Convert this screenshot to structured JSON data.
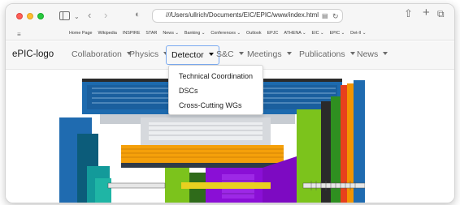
{
  "browser": {
    "url": "///Users/ullrich/Documents/EIC/EPIC/www/index.html"
  },
  "bookmarks": [
    "Home Page",
    "Wikipedia",
    "INSPIRE",
    "STAR",
    "News ⌄",
    "Banking ⌄",
    "Conferences ⌄",
    "Outlook",
    "EPJC",
    "ATHENA ⌄",
    "EIC ⌄",
    "EPIC ⌄",
    "Det-II ⌄"
  ],
  "navbar": {
    "brand": "ePIC-logo",
    "items": [
      {
        "label": "Collaboration"
      },
      {
        "label": "Physics"
      },
      {
        "label": "Detector"
      },
      {
        "label": "S&C"
      },
      {
        "label": "Meetings"
      },
      {
        "label": "Publications"
      },
      {
        "label": "News"
      }
    ],
    "active_index": 2
  },
  "dropdown": {
    "items": [
      "Technical Coordination",
      "DSCs",
      "Cross-Cutting WGs"
    ]
  },
  "colors": {
    "accent_focus": "#7aaaf0",
    "detector_blue": "#1f6bb0",
    "detector_purple": "#8a0fd6",
    "detector_green": "#7cc31c",
    "detector_orange": "#f5a00a"
  }
}
